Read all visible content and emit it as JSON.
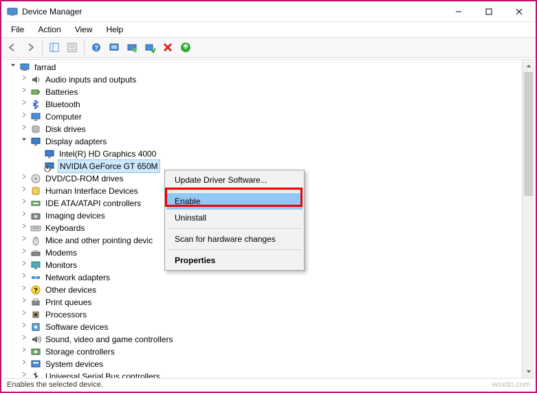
{
  "window": {
    "title": "Device Manager"
  },
  "menu": {
    "file": "File",
    "action": "Action",
    "view": "View",
    "help": "Help"
  },
  "tree": {
    "root": "farrad",
    "items": [
      {
        "label": "Audio inputs and outputs",
        "icon": "audio"
      },
      {
        "label": "Batteries",
        "icon": "battery"
      },
      {
        "label": "Bluetooth",
        "icon": "bluetooth"
      },
      {
        "label": "Computer",
        "icon": "computer"
      },
      {
        "label": "Disk drives",
        "icon": "disk"
      },
      {
        "label": "Display adapters",
        "icon": "display",
        "expanded": true,
        "children": [
          {
            "label": "Intel(R) HD Graphics 4000",
            "icon": "display"
          },
          {
            "label": "NVIDIA GeForce GT 650M",
            "icon": "display-disabled",
            "selected": true,
            "highlight": true
          }
        ]
      },
      {
        "label": "DVD/CD-ROM drives",
        "icon": "dvd"
      },
      {
        "label": "Human Interface Devices",
        "icon": "hid"
      },
      {
        "label": "IDE ATA/ATAPI controllers",
        "icon": "ide"
      },
      {
        "label": "Imaging devices",
        "icon": "imaging"
      },
      {
        "label": "Keyboards",
        "icon": "keyboard"
      },
      {
        "label": "Mice and other pointing devic",
        "icon": "mouse",
        "truncated": true
      },
      {
        "label": "Modems",
        "icon": "modem"
      },
      {
        "label": "Monitors",
        "icon": "monitor"
      },
      {
        "label": "Network adapters",
        "icon": "network"
      },
      {
        "label": "Other devices",
        "icon": "other"
      },
      {
        "label": "Print queues",
        "icon": "print"
      },
      {
        "label": "Processors",
        "icon": "cpu"
      },
      {
        "label": "Software devices",
        "icon": "software"
      },
      {
        "label": "Sound, video and game controllers",
        "icon": "sound"
      },
      {
        "label": "Storage controllers",
        "icon": "storage"
      },
      {
        "label": "System devices",
        "icon": "system"
      },
      {
        "label": "Universal Serial Bus controllers",
        "icon": "usb",
        "cut": true
      }
    ]
  },
  "context_menu": {
    "update": "Update Driver Software...",
    "enable": "Enable",
    "uninstall": "Uninstall",
    "scan": "Scan for hardware changes",
    "properties": "Properties"
  },
  "statusbar": {
    "text": "Enables the selected device.",
    "watermark": "wsxdn.com"
  }
}
